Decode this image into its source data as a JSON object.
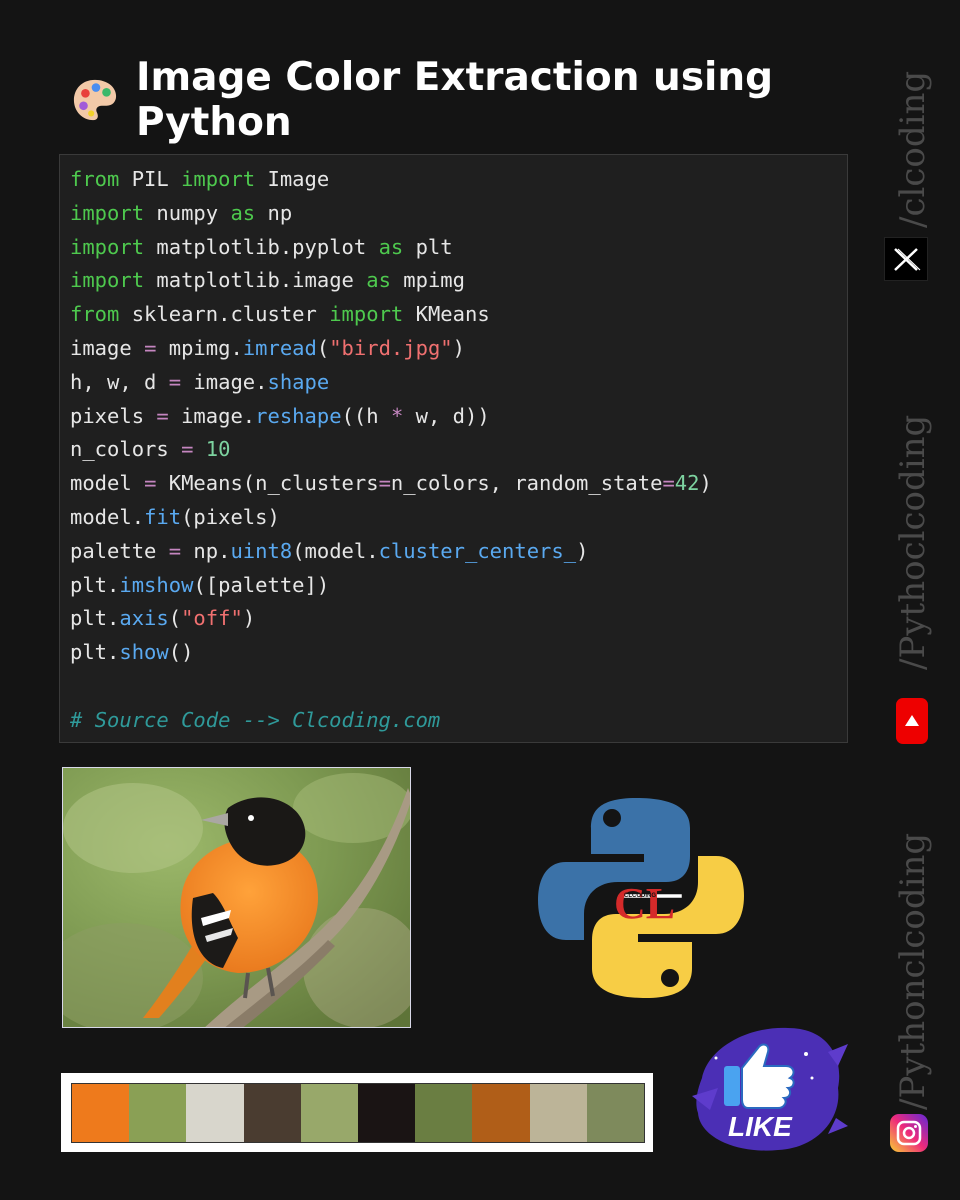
{
  "header": {
    "title": "Image Color Extraction using Python",
    "icon": "artist-palette-icon"
  },
  "code": {
    "lines": [
      [
        {
          "t": "from",
          "c": "kw"
        },
        {
          "t": " PIL "
        },
        {
          "t": "import",
          "c": "kw"
        },
        {
          "t": " Image"
        }
      ],
      [
        {
          "t": "import",
          "c": "kw"
        },
        {
          "t": " numpy "
        },
        {
          "t": "as",
          "c": "kw"
        },
        {
          "t": " np"
        }
      ],
      [
        {
          "t": "import",
          "c": "kw"
        },
        {
          "t": " matplotlib.pyplot "
        },
        {
          "t": "as",
          "c": "kw"
        },
        {
          "t": " plt"
        }
      ],
      [
        {
          "t": "import",
          "c": "kw"
        },
        {
          "t": " matplotlib.image "
        },
        {
          "t": "as",
          "c": "kw"
        },
        {
          "t": " mpimg"
        }
      ],
      [
        {
          "t": "from",
          "c": "kw"
        },
        {
          "t": " sklearn.cluster "
        },
        {
          "t": "import",
          "c": "kw"
        },
        {
          "t": " KMeans"
        }
      ],
      [
        {
          "t": "image "
        },
        {
          "t": "=",
          "c": "op"
        },
        {
          "t": " mpimg."
        },
        {
          "t": "imread",
          "c": "fn"
        },
        {
          "t": "("
        },
        {
          "t": "\"bird.jpg\"",
          "c": "str"
        },
        {
          "t": ")"
        }
      ],
      [
        {
          "t": "h, w, d "
        },
        {
          "t": "=",
          "c": "op"
        },
        {
          "t": " image."
        },
        {
          "t": "shape",
          "c": "fn"
        }
      ],
      [
        {
          "t": "pixels "
        },
        {
          "t": "=",
          "c": "op"
        },
        {
          "t": " image."
        },
        {
          "t": "reshape",
          "c": "fn"
        },
        {
          "t": "((h "
        },
        {
          "t": "*",
          "c": "op"
        },
        {
          "t": " w, d))"
        }
      ],
      [
        {
          "t": "n_colors "
        },
        {
          "t": "=",
          "c": "op"
        },
        {
          "t": " "
        },
        {
          "t": "10",
          "c": "num"
        }
      ],
      [
        {
          "t": "model "
        },
        {
          "t": "=",
          "c": "op"
        },
        {
          "t": " KMeans(n_clusters"
        },
        {
          "t": "=",
          "c": "op"
        },
        {
          "t": "n_colors, random_state"
        },
        {
          "t": "=",
          "c": "op"
        },
        {
          "t": "42",
          "c": "num"
        },
        {
          "t": ")"
        }
      ],
      [
        {
          "t": "model."
        },
        {
          "t": "fit",
          "c": "fn"
        },
        {
          "t": "(pixels)"
        }
      ],
      [
        {
          "t": "palette "
        },
        {
          "t": "=",
          "c": "op"
        },
        {
          "t": " np."
        },
        {
          "t": "uint8",
          "c": "fn"
        },
        {
          "t": "(model."
        },
        {
          "t": "cluster_centers_",
          "c": "fn"
        },
        {
          "t": ")"
        }
      ],
      [
        {
          "t": "plt."
        },
        {
          "t": "imshow",
          "c": "fn"
        },
        {
          "t": "([palette])"
        }
      ],
      [
        {
          "t": "plt."
        },
        {
          "t": "axis",
          "c": "fn"
        },
        {
          "t": "("
        },
        {
          "t": "\"off\"",
          "c": "str"
        },
        {
          "t": ")"
        }
      ],
      [
        {
          "t": "plt."
        },
        {
          "t": "show",
          "c": "fn"
        },
        {
          "t": "()"
        }
      ],
      [],
      [
        {
          "t": "# Source Code --> Clcoding.com",
          "c": "cm"
        }
      ]
    ]
  },
  "image": {
    "icon": "baltimore-oriole-bird-photo"
  },
  "palette": {
    "colors": [
      "#ee7a1c",
      "#8aa055",
      "#d8d6cc",
      "#4a3c30",
      "#98a86a",
      "#1a1414",
      "#6a7e42",
      "#b05e18",
      "#bcb498",
      "#7e8a5c"
    ]
  },
  "logos": {
    "python_icon": "python-logo-icon",
    "cl_text": "CL",
    "cl_small": "CLCODING",
    "like_text": "LIKE"
  },
  "side": {
    "handle1": "/clcoding",
    "handle2": "/Pythoclcoding",
    "handle3": "/Pythonclcoding"
  }
}
